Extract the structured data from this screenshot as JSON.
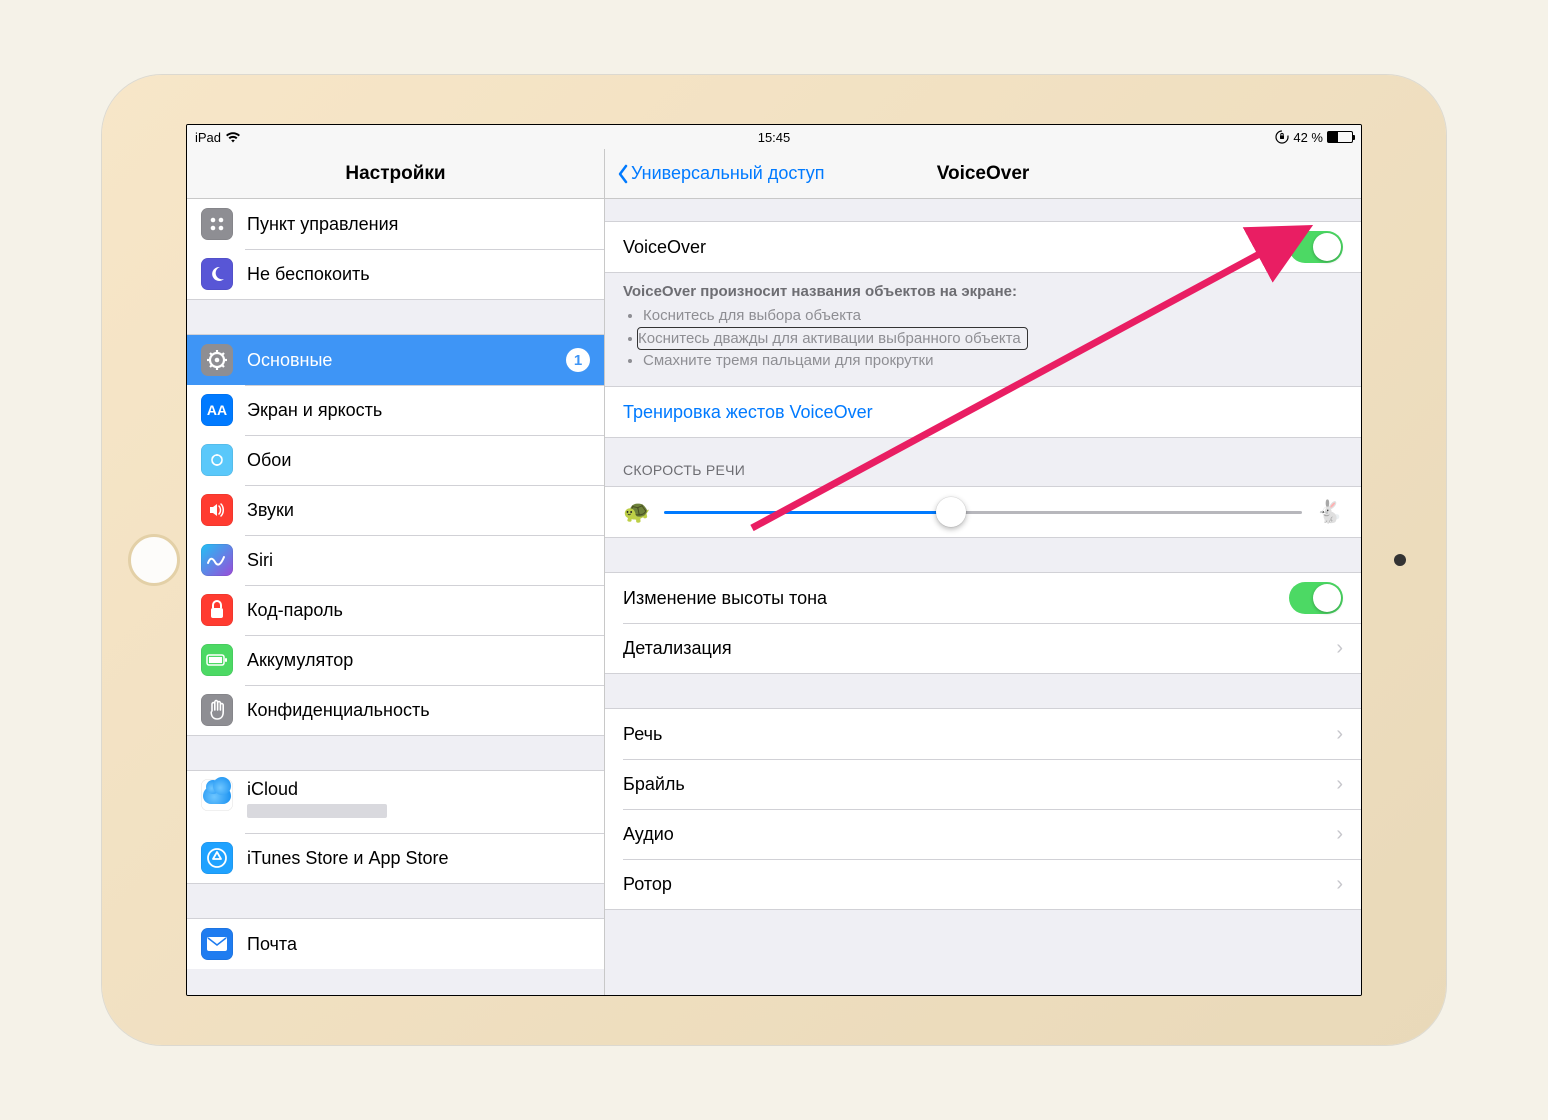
{
  "status": {
    "device": "iPad",
    "time": "15:45",
    "battery_percent": "42 %"
  },
  "sidebar": {
    "title": "Настройки",
    "items": {
      "control_center": "Пункт управления",
      "dnd": "Не беспокоить",
      "general": "Основные",
      "general_badge": "1",
      "display": "Экран и яркость",
      "wallpaper": "Обои",
      "sounds": "Звуки",
      "siri": "Siri",
      "passcode": "Код-пароль",
      "battery": "Аккумулятор",
      "privacy": "Конфиденциальность",
      "icloud": "iCloud",
      "itunes": "iTunes Store и App Store",
      "mail": "Почта"
    }
  },
  "detail": {
    "back": "Универсальный доступ",
    "title": "VoiceOver",
    "main_toggle": "VoiceOver",
    "note_head": "VoiceOver произносит названия объектов на экране:",
    "note_1": "Коснитесь для выбора объекта",
    "note_2": "Коснитесь дважды для активации выбранного объекта",
    "note_3": "Смахните тремя пальцами для прокрутки",
    "practice": "Тренировка жестов VoiceOver",
    "rate_header": "СКОРОСТЬ РЕЧИ",
    "pitch": "Изменение высоты тона",
    "verbosity": "Детализация",
    "speech": "Речь",
    "braille": "Брайль",
    "audio": "Аудио",
    "rotor": "Ротор"
  }
}
